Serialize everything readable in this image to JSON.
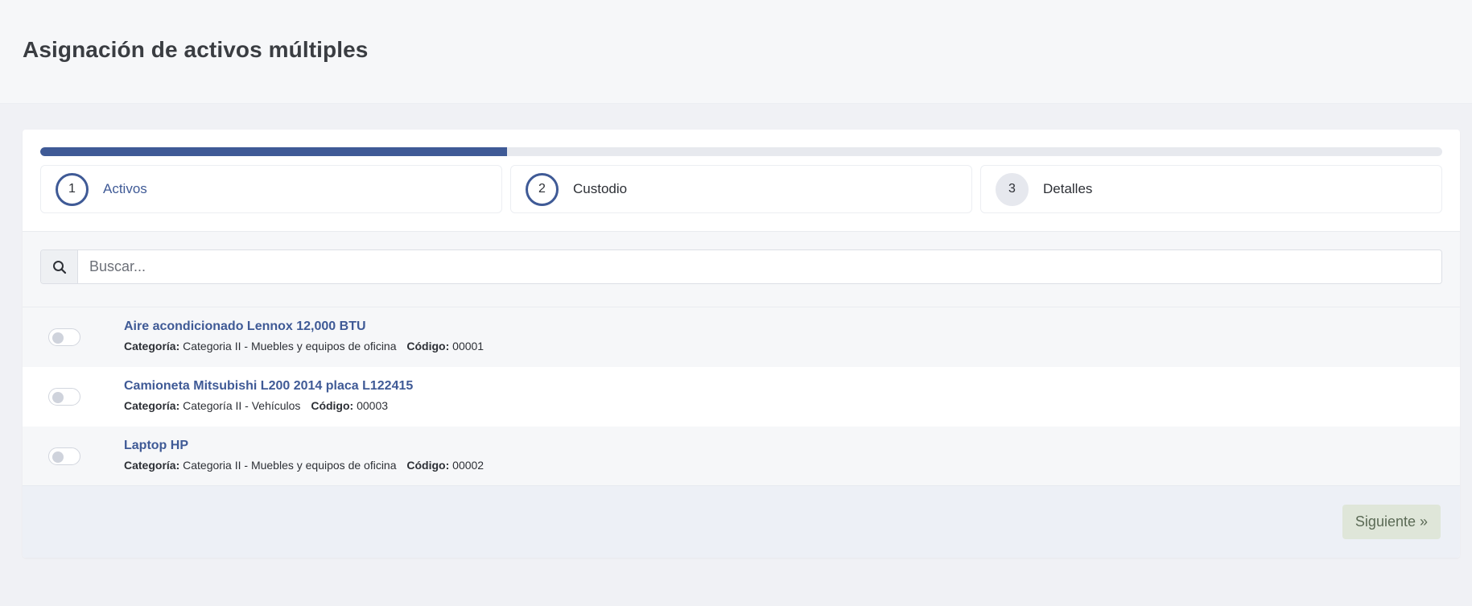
{
  "page": {
    "title": "Asignación de activos múltiples"
  },
  "wizard": {
    "progress_fraction": 0.333,
    "steps": [
      {
        "number": "1",
        "label": "Activos",
        "state": "active"
      },
      {
        "number": "2",
        "label": "Custodio",
        "state": "current"
      },
      {
        "number": "3",
        "label": "Detalles",
        "state": "pending"
      }
    ]
  },
  "search": {
    "placeholder": "Buscar...",
    "value": "",
    "icon": "search-icon"
  },
  "labels": {
    "category": "Categoría:",
    "code": "Código:"
  },
  "assets": [
    {
      "name": "Aire acondicionado Lennox 12,000 BTU",
      "category": "Categoria II - Muebles y equipos de oficina",
      "code": "00001",
      "selected": false
    },
    {
      "name": "Camioneta Mitsubishi L200 2014 placa L122415",
      "category": "Categoría II - Vehículos",
      "code": "00003",
      "selected": false
    },
    {
      "name": "Laptop HP",
      "category": "Categoria II - Muebles y equipos de oficina",
      "code": "00002",
      "selected": false
    }
  ],
  "footer": {
    "next_label": "Siguiente »"
  },
  "colors": {
    "accent": "#3f5a96",
    "next_button_bg": "#dfe6d9"
  }
}
